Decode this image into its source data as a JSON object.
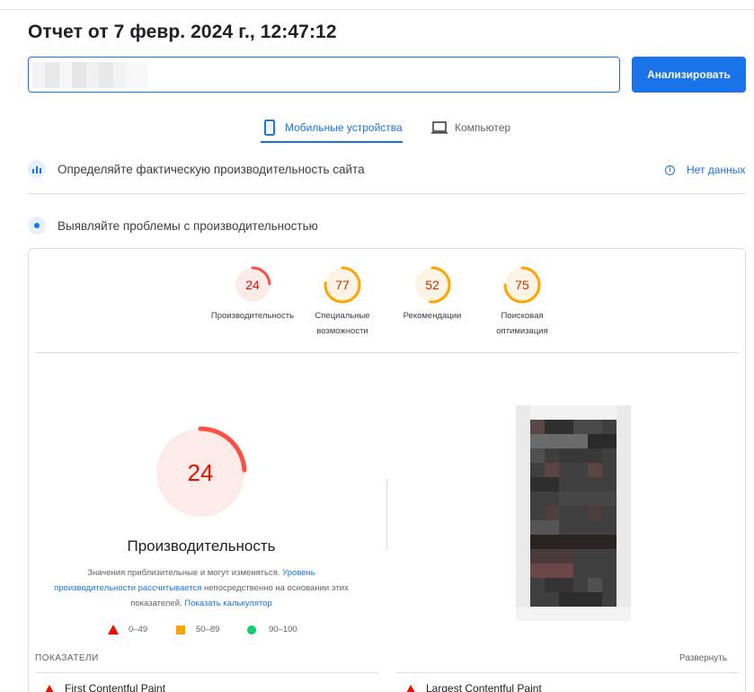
{
  "report": {
    "title": "Отчет от 7 февр. 2024 г., 12:47:12"
  },
  "search": {
    "url_value": "",
    "analyze_label": "Анализировать"
  },
  "tabs": [
    {
      "label": "Мобильные устройства",
      "icon": "phone-icon",
      "active": true
    },
    {
      "label": "Компьютер",
      "icon": "laptop-icon",
      "active": false
    }
  ],
  "field_data": {
    "heading": "Определяйте фактическую производительность сайта",
    "status": "Нет данных"
  },
  "lab_data": {
    "heading": "Выявляйте проблемы с производительностью"
  },
  "scores": [
    {
      "value": "24",
      "label_line1": "Производительность",
      "label_line2": "",
      "color": "#ff4e42",
      "bg": "#fdebea",
      "fraction": 0.24
    },
    {
      "value": "77",
      "label_line1": "Специальные",
      "label_line2": "возможности",
      "color": "#ffa400",
      "bg": "#fef4e6",
      "fraction": 0.77
    },
    {
      "value": "52",
      "label_line1": "Рекомендации",
      "label_line2": "",
      "color": "#ffa400",
      "bg": "#fef4e6",
      "fraction": 0.52
    },
    {
      "value": "75",
      "label_line1": "Поисковая",
      "label_line2": "оптимизация",
      "color": "#ffa400",
      "bg": "#fef4e6",
      "fraction": 0.75
    }
  ],
  "performance": {
    "score": "24",
    "fraction": 0.24,
    "title": "Производительность",
    "note_prefix": "Значения приблизительные и могут изменяться. ",
    "note_link": "Уровень производительности рассчитывается",
    "note_middle": " непосредственно на основании этих показателей. ",
    "calc_link": "Показать калькулятор"
  },
  "legend": [
    {
      "range": "0–49",
      "shape": "triangle",
      "color": "#eb0f00"
    },
    {
      "range": "50–89",
      "shape": "square",
      "color": "#ffa400"
    },
    {
      "range": "90–100",
      "shape": "circle",
      "color": "#0cce6b"
    }
  ],
  "metrics": {
    "header": "ПОКАЗАТЕЛИ",
    "expand_label": "Развернуть",
    "items": [
      {
        "name": "First Contentful Paint",
        "status": "poor"
      },
      {
        "name": "Largest Contentful Paint",
        "status": "poor"
      }
    ]
  },
  "colors": {
    "accent": "#1a73e8",
    "poor": "#ff4e42",
    "average": "#ffa400",
    "good": "#0cce6b"
  }
}
